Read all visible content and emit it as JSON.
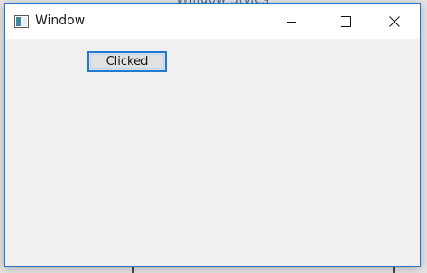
{
  "background": {
    "partial_text": "Window Styles"
  },
  "window": {
    "title": "Window",
    "icons": {
      "app": "app-window-icon",
      "minimize": "minimize-icon",
      "maximize": "maximize-icon",
      "close": "close-icon"
    },
    "colors": {
      "border": "#2b74c4",
      "titlebar": "#ffffff",
      "client": "#f0f0f0"
    }
  },
  "client": {
    "button_label": "Clicked",
    "button_focus_color": "#1f7ad1"
  }
}
